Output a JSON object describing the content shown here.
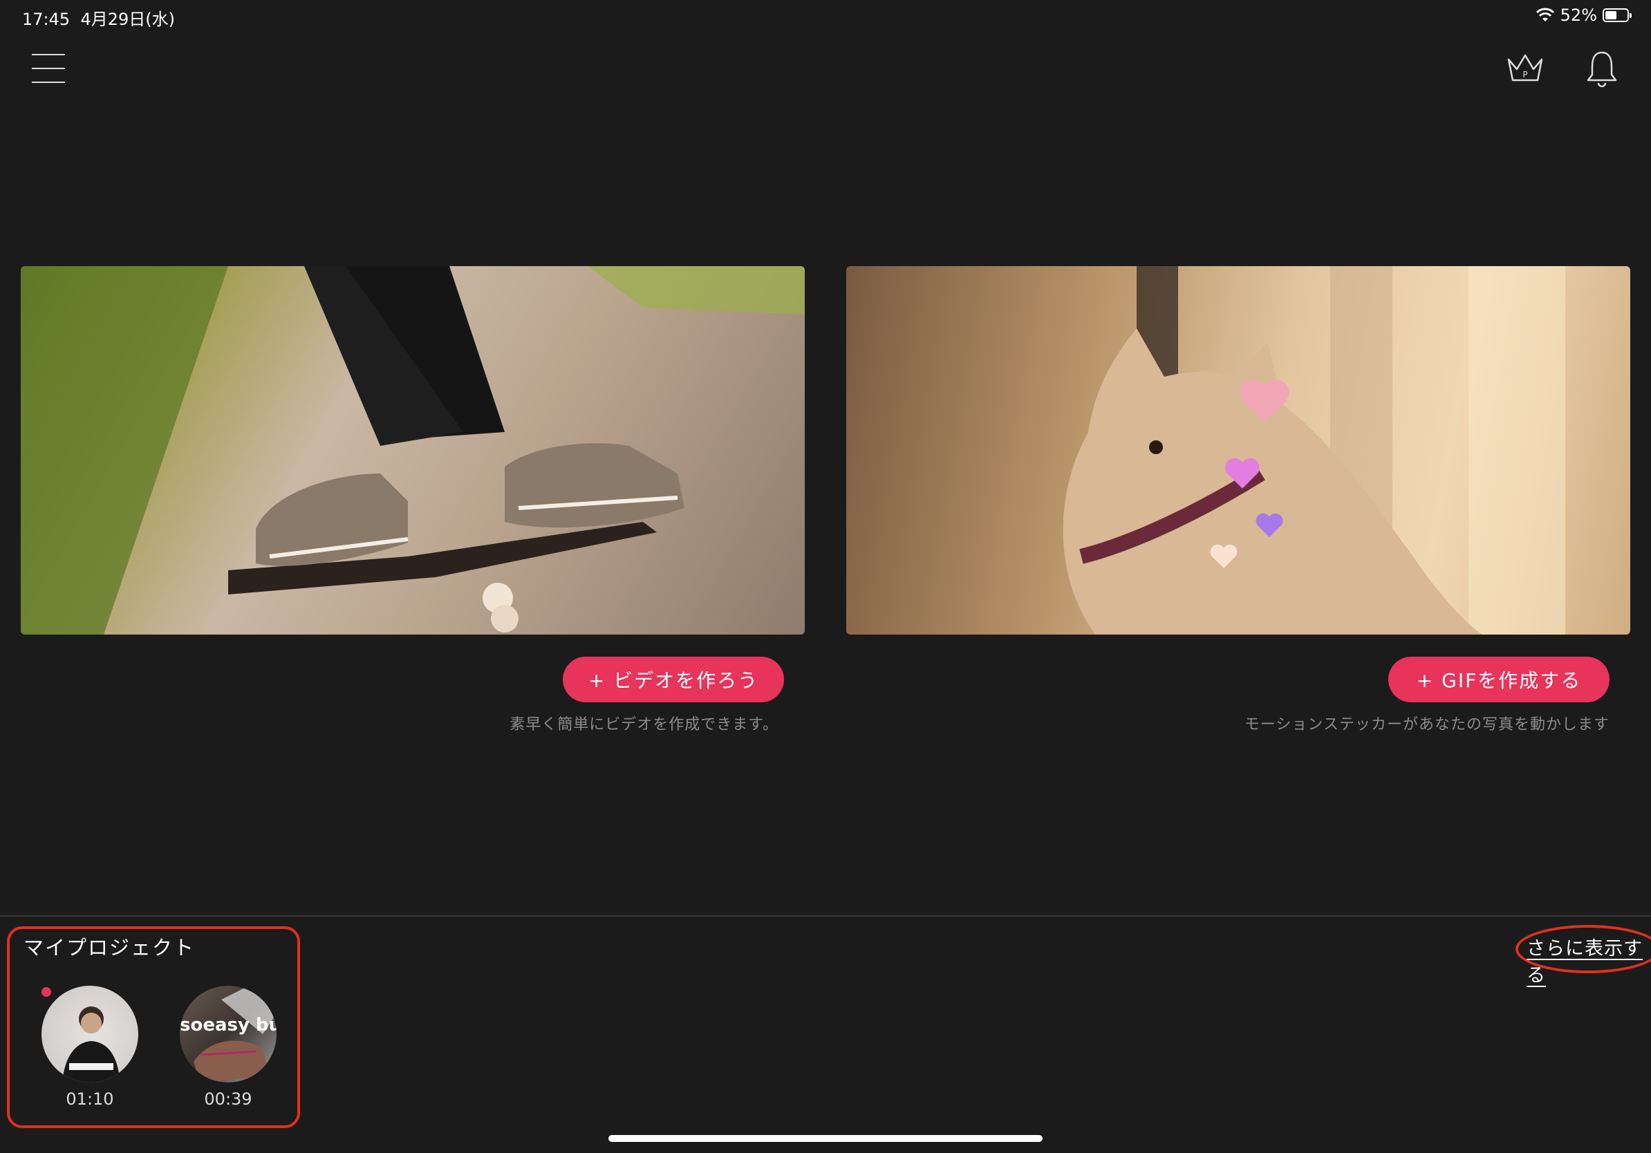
{
  "status_bar": {
    "time": "17:45",
    "date": "4月29日(水)",
    "battery_percent_label": "52%",
    "battery_level": 0.52,
    "icons": [
      "wifi-icon",
      "battery-icon"
    ]
  },
  "header": {
    "menu_icon": "hamburger-menu-icon",
    "premium_icon": "crown-icon",
    "notification_icon": "bell-icon"
  },
  "cards": {
    "video": {
      "button_label": "+ ビデオを作ろう",
      "description": "素早く簡単にビデオを作成できます。"
    },
    "gif": {
      "button_label": "+ GIFを作成する",
      "description": "モーションステッカーがあなたの写真を動かします"
    }
  },
  "projects": {
    "title": "マイプロジェクト",
    "show_more": "さらに表示する",
    "items": [
      {
        "duration": "01:10",
        "is_new": true
      },
      {
        "duration": "00:39",
        "thumb_text": "soeasy bud"
      }
    ]
  },
  "colors": {
    "accent": "#e8335a",
    "highlight": "#e0301e",
    "background": "#1b1b1b"
  }
}
